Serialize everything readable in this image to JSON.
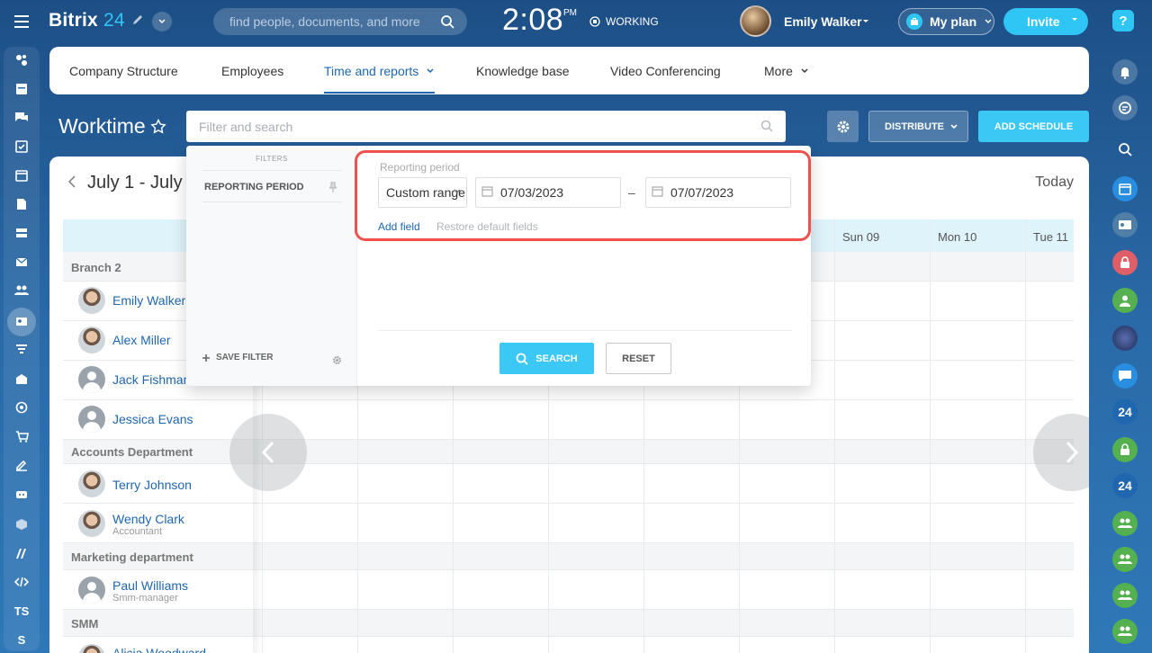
{
  "header": {
    "logo_text": "Bitrix",
    "logo_num": "24",
    "search_placeholder": "find people, documents, and more",
    "clock": "2:08",
    "ampm": "PM",
    "status": "WORKING",
    "user_name": "Emily Walker",
    "my_plan_label": "My plan",
    "invite_label": "Invite",
    "help_label": "?"
  },
  "nav": {
    "items": [
      {
        "label": "Company Structure"
      },
      {
        "label": "Employees"
      },
      {
        "label": "Time and reports"
      },
      {
        "label": "Knowledge base"
      },
      {
        "label": "Video Conferencing"
      },
      {
        "label": "More"
      }
    ]
  },
  "toolbar": {
    "title": "Worktime",
    "filter_placeholder": "Filter and search",
    "distribute_label": "DISTRIBUTE",
    "add_schedule_label": "ADD SCHEDULE"
  },
  "schedule": {
    "period": "July 1 - July",
    "today_label": "Today",
    "days": [
      "Sun 09",
      "Mon 10",
      "Tue 11"
    ],
    "groups": [
      {
        "name": "Branch 2"
      },
      {
        "name": "Accounts Department"
      },
      {
        "name": "Marketing department"
      },
      {
        "name": "SMM"
      }
    ],
    "employees": [
      {
        "name": "Emily Walker",
        "title": ""
      },
      {
        "name": "Alex Miller",
        "title": ""
      },
      {
        "name": "Jack Fishman",
        "title": ""
      },
      {
        "name": "Jessica Evans",
        "title": ""
      },
      {
        "name": "Terry Johnson",
        "title": ""
      },
      {
        "name": "Wendy Clark",
        "title": "Accountant"
      },
      {
        "name": "Paul Williams",
        "title": "Smm-manager"
      },
      {
        "name": "Alicia Woodward",
        "title": ""
      }
    ]
  },
  "filter_popup": {
    "filters_title": "FILTERS",
    "preset": "REPORTING PERIOD",
    "save_filter_label": "SAVE FILTER",
    "field_label": "Reporting period",
    "range_type": "Custom range",
    "date_from": "07/03/2023",
    "date_separator": "–",
    "date_to": "07/07/2023",
    "add_field_label": "Add field",
    "restore_label": "Restore default fields",
    "search_label": "SEARCH",
    "reset_label": "RESET"
  },
  "right_bar": {
    "badge_label": "24"
  },
  "left_bar": {
    "ts_label": "TS",
    "s_label": "S"
  },
  "colors": {
    "accent": "#2fc6f6",
    "link": "#2067b0",
    "highlight": "#f0504e"
  }
}
